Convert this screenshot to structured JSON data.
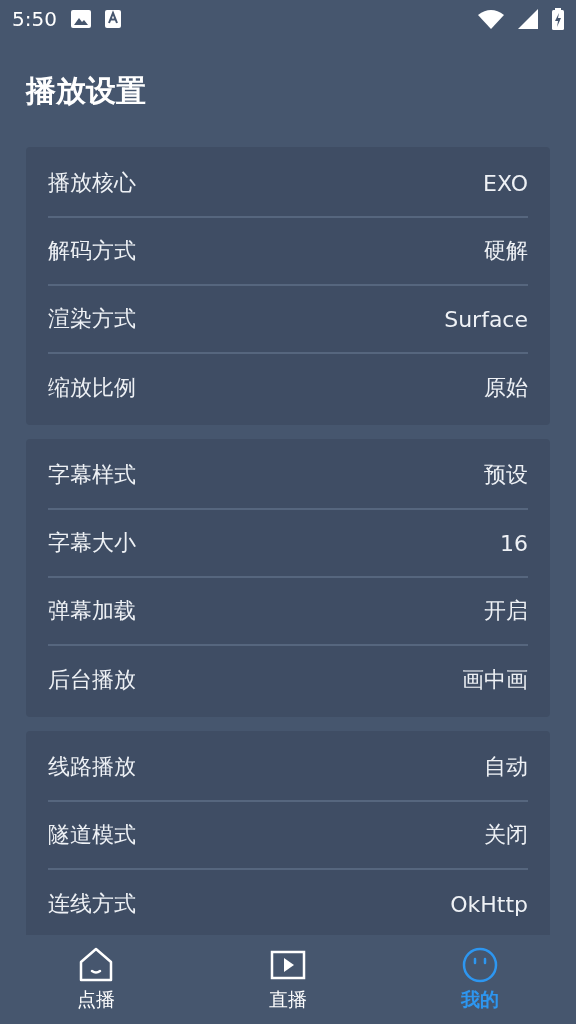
{
  "status_bar": {
    "time": "5:50"
  },
  "title": "播放设置",
  "groups": [
    {
      "rows": [
        {
          "label": "播放核心",
          "value": "EXO"
        },
        {
          "label": "解码方式",
          "value": "硬解"
        },
        {
          "label": "渲染方式",
          "value": "Surface"
        },
        {
          "label": "缩放比例",
          "value": "原始"
        }
      ]
    },
    {
      "rows": [
        {
          "label": "字幕样式",
          "value": "预设"
        },
        {
          "label": "字幕大小",
          "value": "16"
        },
        {
          "label": "弹幕加载",
          "value": "开启"
        },
        {
          "label": "后台播放",
          "value": "画中画"
        }
      ]
    },
    {
      "rows": [
        {
          "label": "线路播放",
          "value": "自动"
        },
        {
          "label": "隧道模式",
          "value": "关闭"
        },
        {
          "label": "连线方式",
          "value": "OkHttp"
        }
      ]
    }
  ],
  "nav": [
    {
      "label": "点播",
      "kind": "home",
      "selected": false
    },
    {
      "label": "直播",
      "kind": "play",
      "selected": false
    },
    {
      "label": "我的",
      "kind": "face",
      "selected": true
    }
  ]
}
